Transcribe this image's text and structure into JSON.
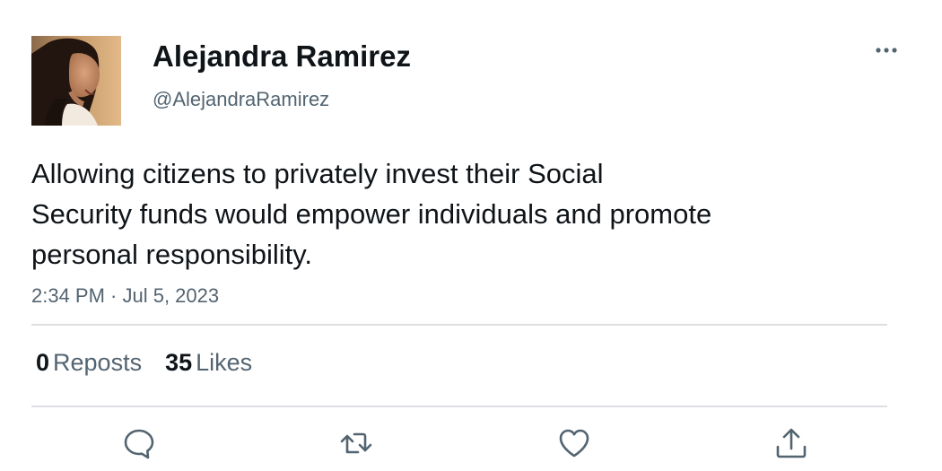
{
  "author": {
    "display_name": "Alejandra Ramirez",
    "handle": "@AlejandraRamirez",
    "avatar_icon": "profile-photo"
  },
  "tweet": {
    "text_lines": [
      "Allowing citizens to privately invest their Social",
      "Security funds would empower individuals and promote",
      "personal responsibility."
    ],
    "timestamp": "2:34 PM · Jul 5, 2023"
  },
  "stats": {
    "reposts": {
      "count": "0",
      "label": "Reposts"
    },
    "likes": {
      "count": "35",
      "label": "Likes"
    }
  },
  "icons": {
    "more": "more-horizontal-icon",
    "reply": "reply-icon",
    "repost": "repost-icon",
    "like": "heart-icon",
    "share": "share-icon"
  },
  "colors": {
    "text_primary": "#0f1419",
    "text_secondary": "#536471",
    "divider": "#dddfe2"
  }
}
